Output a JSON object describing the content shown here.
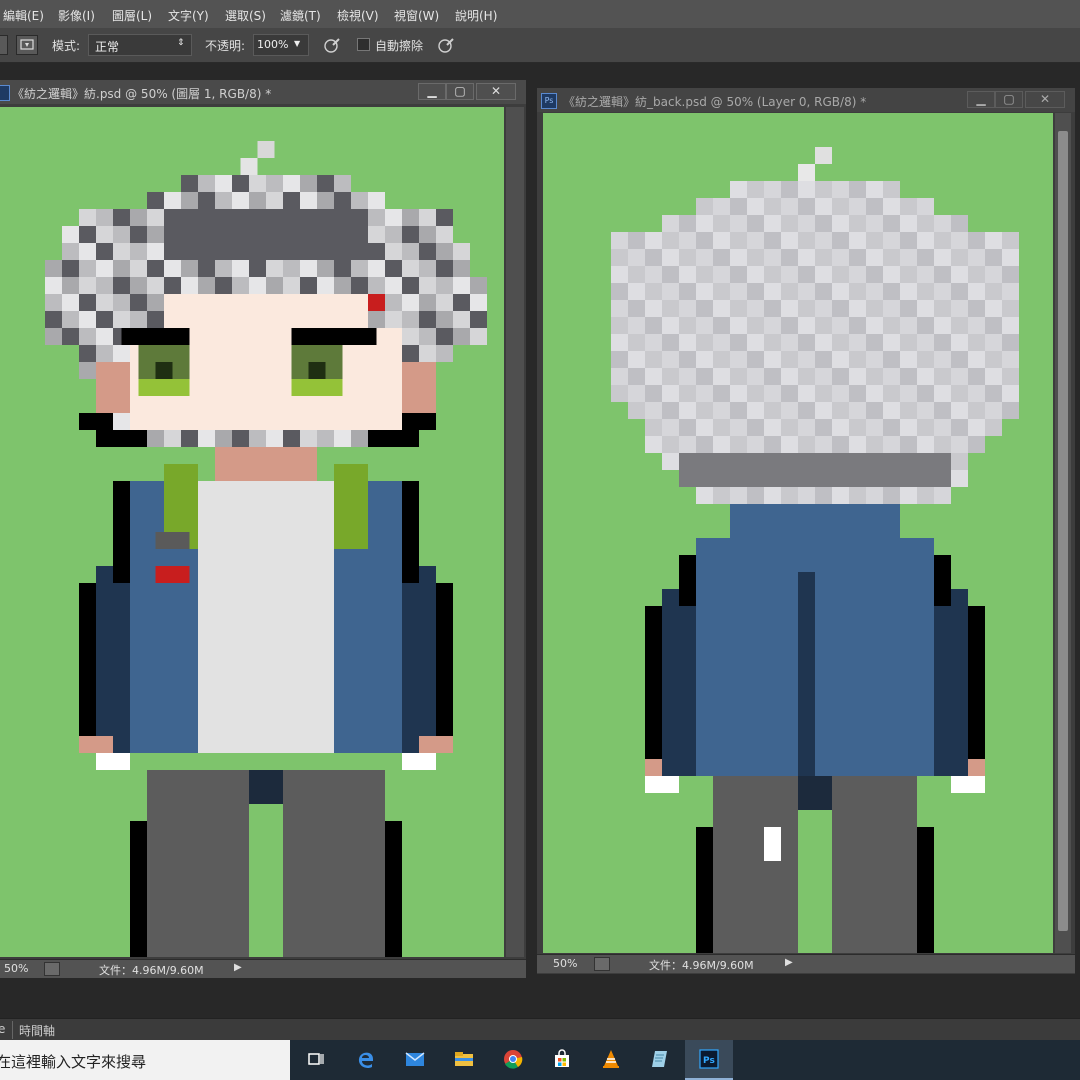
{
  "menu": [
    "編輯(E)",
    "影像(I)",
    "圖層(L)",
    "文字(Y)",
    "選取(S)",
    "濾鏡(T)",
    "檢視(V)",
    "視窗(W)",
    "說明(H)"
  ],
  "options": {
    "mode_label": "模式:",
    "mode_value": "正常",
    "opacity_label": "不透明:",
    "opacity_value": "100%",
    "auto_erase_label": "自動擦除",
    "auto_erase_checked": false
  },
  "doc_left": {
    "title": "《紡之邏輯》紡.psd @ 50% (圖層 1, RGB/8) *",
    "tab_icon": "Ps",
    "zoom": "50%",
    "file_info": "文件：4.96M/9.60M"
  },
  "doc_right": {
    "title": "《紡之邏輯》紡_back.psd @ 50% (Layer 0, RGB/8) *",
    "tab_icon": "Ps",
    "zoom": "50%",
    "file_info": "文件：4.96M/9.60M"
  },
  "timeline": {
    "tab_partial": "e",
    "tab_label": "時間軸"
  },
  "taskbar": {
    "search_text": "在這裡輸入文字來搜尋",
    "apps": [
      "task-view-icon",
      "edge-icon",
      "mail-icon",
      "file-explorer-icon",
      "chrome-icon",
      "store-icon",
      "vlc-icon",
      "notepad-icon",
      "photoshop-icon"
    ],
    "active_app": "photoshop-icon"
  },
  "colors": {
    "canvas_bg": "#7ec46c",
    "hair_light": "#d2d2d6",
    "hair_dark": "#5a5a60",
    "skin": "#fbe9de",
    "skin_shadow": "#d49a88",
    "eye_green": "#94c238",
    "jacket_blue": "#3f6590",
    "jacket_dark": "#1f3550",
    "collar_green": "#78a82a",
    "shirt_white": "#e2e2e2",
    "pants_gray": "#5c5c5c",
    "shoe_olive": "#4a5a2a",
    "accent_red": "#c81e1e",
    "outline": "#000000"
  }
}
